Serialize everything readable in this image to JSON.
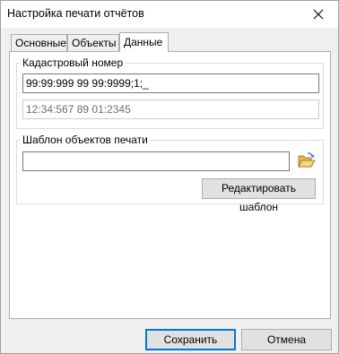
{
  "window": {
    "title": "Настройка печати отчётов"
  },
  "tabs": [
    {
      "label": "Основные"
    },
    {
      "label": "Объекты"
    },
    {
      "label": "Данные"
    }
  ],
  "cadastral_group": {
    "label": "Кадастровый номер",
    "mask_value": "99:99:999 99 99:9999;1;_",
    "preview_value": "12:34:567 89 01:2345"
  },
  "template_group": {
    "label": "Шаблон объектов печати",
    "path_value": "",
    "edit_button_label": "Редактировать шаблон"
  },
  "footer": {
    "save_label": "Сохранить",
    "cancel_label": "Отмена"
  },
  "icons": {
    "close": "close-icon",
    "browse": "open-folder-icon"
  }
}
